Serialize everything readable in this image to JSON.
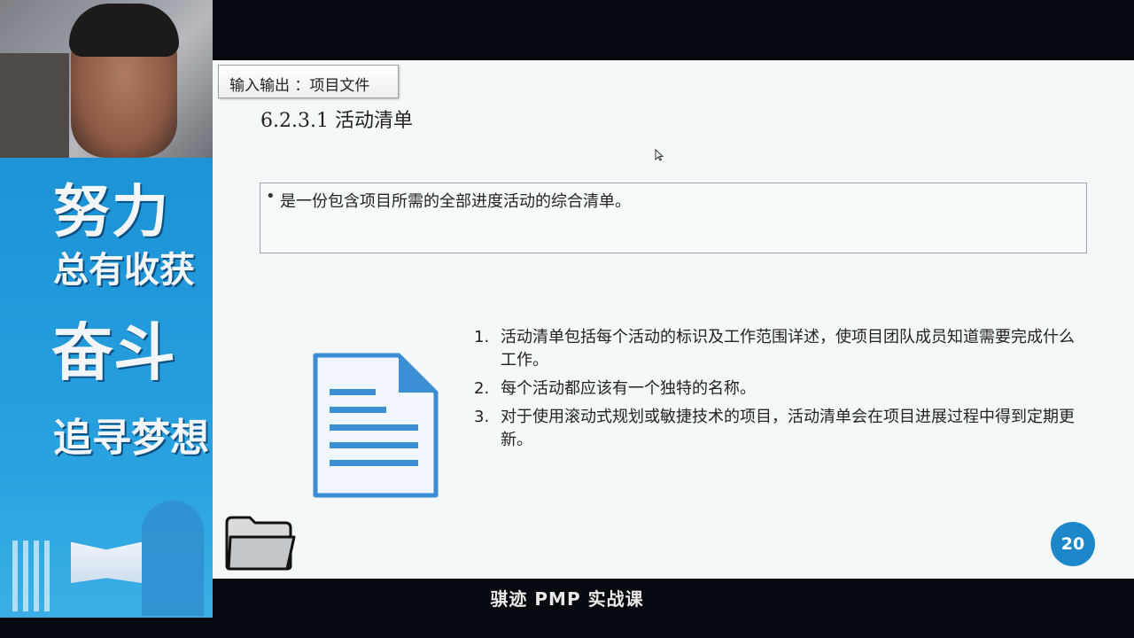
{
  "banner": {
    "slogan_line1": "努力",
    "slogan_line2": "总有收获",
    "slogan_line3": "奋斗",
    "slogan_line4": "追寻梦想"
  },
  "slide": {
    "tab_label": "输入输出 ：项目文件",
    "title": "6.2.3.1  活动清单",
    "definition": "是一份包含项目所需的全部进度活动的综合清单。",
    "points": [
      {
        "num": "1.",
        "text": "活动清单包括每个活动的标识及工作范围详述，使项目团队成员知道需要完成什么工作。"
      },
      {
        "num": "2.",
        "text": "每个活动都应该有一个独特的名称。"
      },
      {
        "num": "3.",
        "text": "对于使用滚动式规划或敏捷技术的项目，活动清单会在项目进展过程中得到定期更新。"
      }
    ],
    "page_number": "20"
  },
  "footer": {
    "brand": "骐迹 PMP 实战课"
  },
  "colors": {
    "accent_blue": "#1c87c9",
    "banner_blue": "#1e96d8",
    "slide_bg": "#f4f8f9"
  },
  "icons": [
    "document-icon",
    "folder-icon",
    "cursor-icon"
  ]
}
